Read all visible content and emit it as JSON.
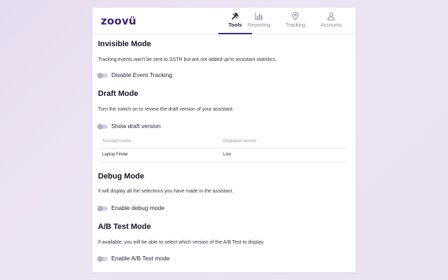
{
  "brand": {
    "logo_text": "zoovü",
    "accent": "#3b2a8f"
  },
  "nav": [
    {
      "label": "Tools",
      "icon": "tools-icon",
      "active": true
    },
    {
      "label": "Reporting",
      "icon": "bar-chart-icon",
      "active": false
    },
    {
      "label": "Tracking",
      "icon": "location-pin-icon",
      "active": false
    },
    {
      "label": "Accounts",
      "icon": "user-icon",
      "active": false
    }
  ],
  "sections": {
    "invisible": {
      "title": "Invisible Mode",
      "description": "Tracking events won't be sent to SSTR but are not added up to assistant statistics.",
      "toggle_label": "Disable Event Tracking",
      "toggle_on": false
    },
    "draft": {
      "title": "Draft Mode",
      "description": "Turn the switch on to review the draft version of your assistant.",
      "toggle_label": "Show draft version",
      "toggle_on": false,
      "table": {
        "columns": [
          "Assistant name",
          "Displayed version"
        ],
        "rows": [
          [
            "Laptop Finder",
            "Live"
          ]
        ]
      }
    },
    "debug": {
      "title": "Debug Mode",
      "description": "It will display all the selections you have made in the assistant.",
      "toggle_label": "Enable debug mode",
      "toggle_on": false
    },
    "ab": {
      "title": "A/B Test Mode",
      "description": "If available, you will be able to select which version of the A/B Test to display.",
      "toggle_label": "Enable A/B Test mode",
      "toggle_on": false
    }
  }
}
